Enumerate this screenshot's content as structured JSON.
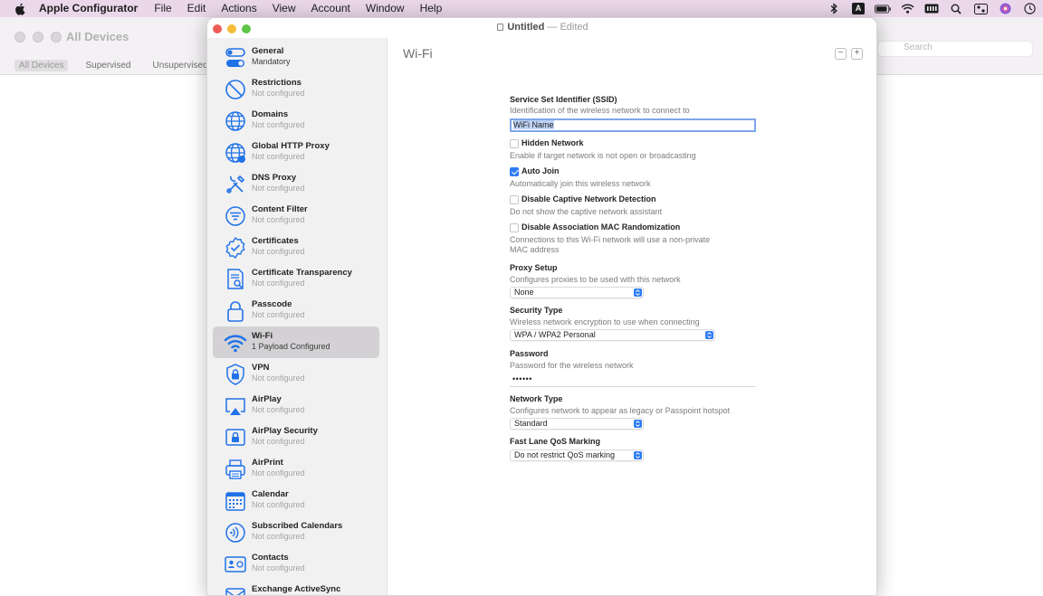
{
  "menubar": {
    "app_name": "Apple Configurator",
    "menus": [
      "File",
      "Edit",
      "Actions",
      "View",
      "Account",
      "Window",
      "Help"
    ],
    "status_icons": [
      "bluetooth-icon",
      "input-source-icon",
      "battery-icon",
      "wifi-icon",
      "keyboard-icon",
      "spotlight-icon",
      "control-center-icon",
      "siri-icon",
      "clock-icon"
    ],
    "input_source": "A"
  },
  "background_window": {
    "title": "All Devices",
    "filters": [
      "All Devices",
      "Supervised",
      "Unsupervised"
    ],
    "search_placeholder": "Search"
  },
  "window": {
    "doc_title": "Untitled",
    "doc_separator": "—",
    "doc_status": "Edited"
  },
  "sidebar": {
    "items": [
      {
        "title": "General",
        "subtitle": "Mandatory",
        "icon": "toggle-switches-icon"
      },
      {
        "title": "Restrictions",
        "subtitle": "Not configured",
        "icon": "no-entry-icon"
      },
      {
        "title": "Domains",
        "subtitle": "Not configured",
        "icon": "globe-icon"
      },
      {
        "title": "Global HTTP Proxy",
        "subtitle": "Not configured",
        "icon": "globe-proxy-icon"
      },
      {
        "title": "DNS Proxy",
        "subtitle": "Not configured",
        "icon": "tools-icon"
      },
      {
        "title": "Content Filter",
        "subtitle": "Not configured",
        "icon": "filter-icon"
      },
      {
        "title": "Certificates",
        "subtitle": "Not configured",
        "icon": "certificate-seal-icon"
      },
      {
        "title": "Certificate Transparency",
        "subtitle": "Not configured",
        "icon": "document-search-icon"
      },
      {
        "title": "Passcode",
        "subtitle": "Not configured",
        "icon": "lock-icon"
      },
      {
        "title": "Wi-Fi",
        "subtitle": "1 Payload Configured",
        "icon": "wifi-icon"
      },
      {
        "title": "VPN",
        "subtitle": "Not configured",
        "icon": "vpn-shield-icon"
      },
      {
        "title": "AirPlay",
        "subtitle": "Not configured",
        "icon": "airplay-icon"
      },
      {
        "title": "AirPlay Security",
        "subtitle": "Not configured",
        "icon": "airplay-lock-icon"
      },
      {
        "title": "AirPrint",
        "subtitle": "Not configured",
        "icon": "printer-icon"
      },
      {
        "title": "Calendar",
        "subtitle": "Not configured",
        "icon": "calendar-icon"
      },
      {
        "title": "Subscribed Calendars",
        "subtitle": "Not configured",
        "icon": "broadcast-icon"
      },
      {
        "title": "Contacts",
        "subtitle": "Not configured",
        "icon": "contact-card-icon"
      },
      {
        "title": "Exchange ActiveSync",
        "subtitle": "",
        "icon": "exchange-icon"
      }
    ],
    "selected_index": 9
  },
  "content": {
    "title": "Wi-Fi",
    "remove_label": "−",
    "add_label": "+",
    "ssid": {
      "label": "Service Set Identifier (SSID)",
      "description": "Identification of the wireless network to connect to",
      "value": "WiFi Name"
    },
    "hidden_network": {
      "label": "Hidden Network",
      "description": "Enable if target network is not open or broadcasting",
      "checked": false
    },
    "auto_join": {
      "label": "Auto Join",
      "description": "Automatically join this wireless network",
      "checked": true
    },
    "captive": {
      "label": "Disable Captive Network Detection",
      "description": "Do not show the captive network assistant",
      "checked": false
    },
    "mac_random": {
      "label": "Disable Association MAC Randomization",
      "description_line1": "Connections to this Wi-Fi network will use a non-private",
      "description_line2": "MAC address",
      "checked": false
    },
    "proxy": {
      "label": "Proxy Setup",
      "description": "Configures proxies to be used with this network",
      "value": "None"
    },
    "security": {
      "label": "Security Type",
      "description": "Wireless network encryption to use when connecting",
      "value": "WPA / WPA2 Personal"
    },
    "password": {
      "label": "Password",
      "description": "Password for the wireless network",
      "value": "••••••"
    },
    "network_type": {
      "label": "Network Type",
      "description": "Configures network to appear as legacy or Passpoint hotspot",
      "value": "Standard"
    },
    "qos": {
      "label": "Fast Lane QoS Marking",
      "value": "Do not restrict QoS marking"
    }
  },
  "colors": {
    "accent": "#2f7cf6",
    "icon_blue": "#1f72e8",
    "menubar_bg": "#ead8ea",
    "sidebar_bg": "#f2f1f2",
    "selection_bg": "#d3d1d4"
  }
}
